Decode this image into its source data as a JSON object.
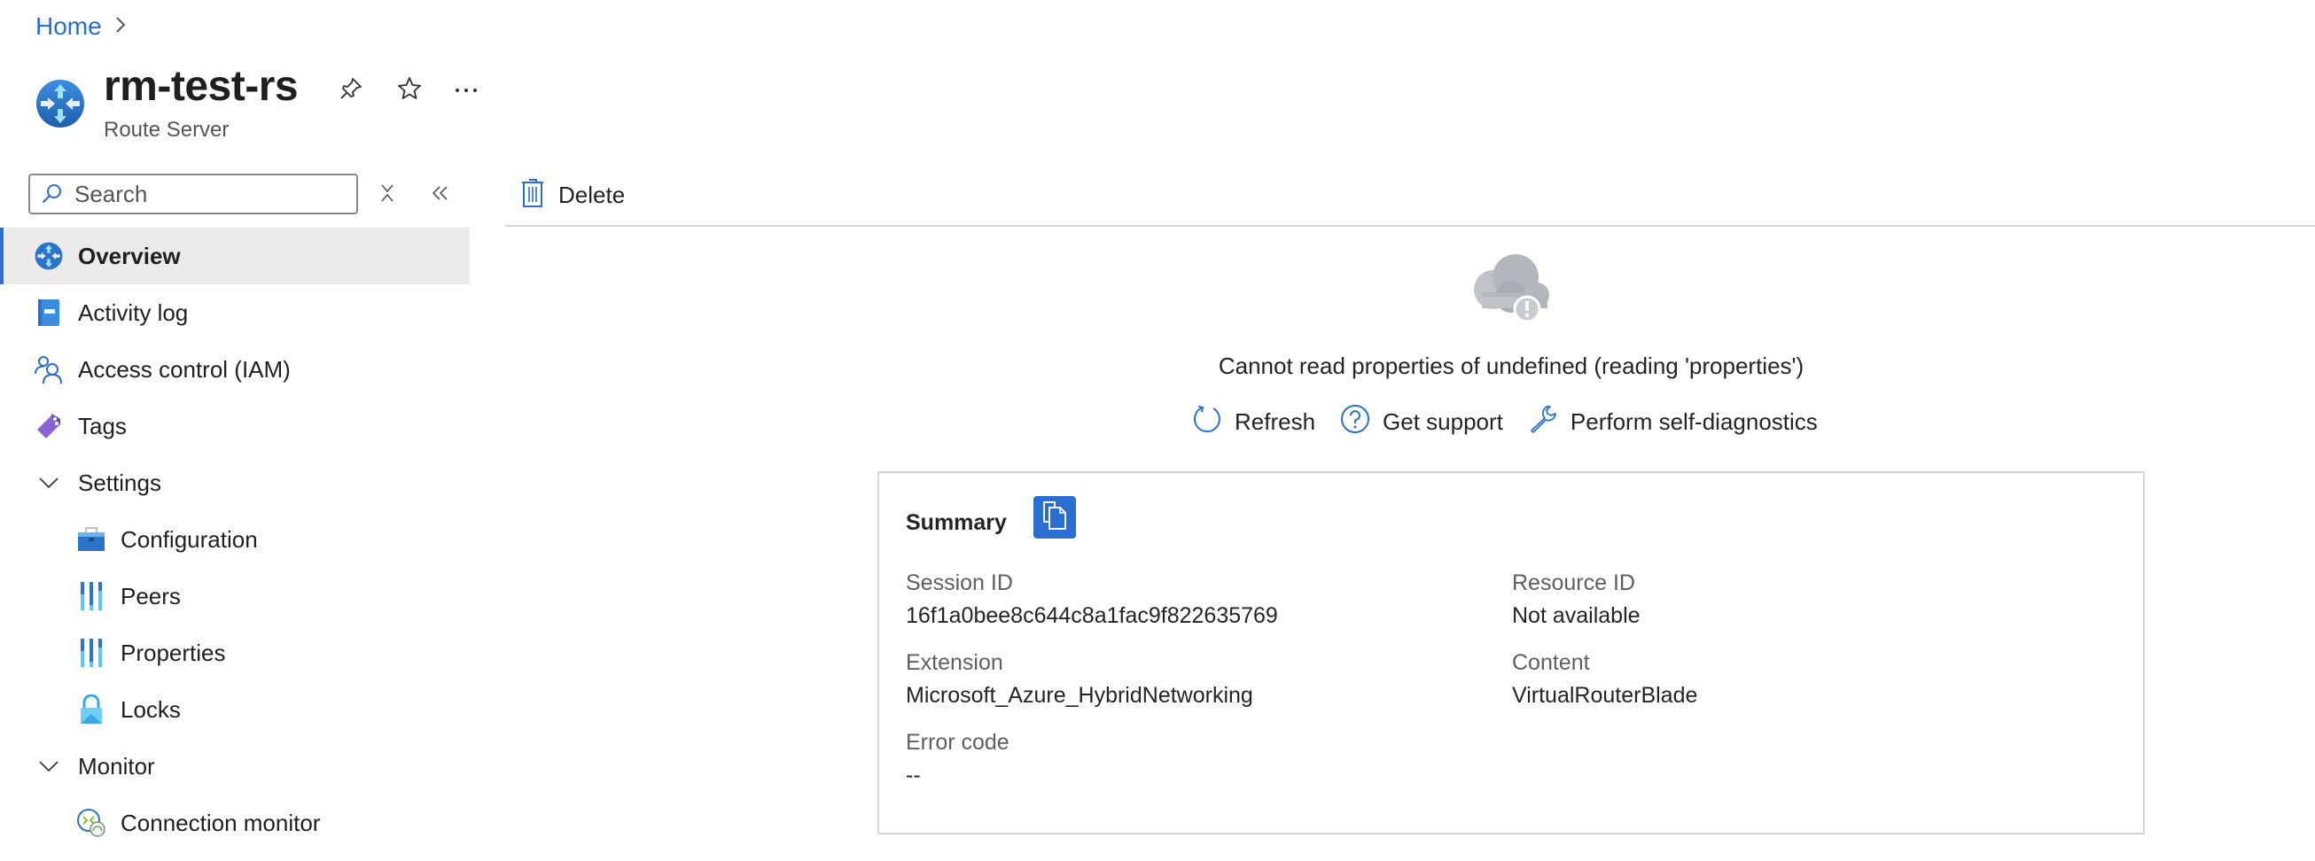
{
  "breadcrumb": {
    "home": "Home",
    "separator": "›"
  },
  "resource": {
    "title": "rm-test-rs",
    "type": "Route Server",
    "icon": "route-server-icon"
  },
  "header_actions": [
    {
      "name": "pin",
      "icon": "pin-icon"
    },
    {
      "name": "favorite",
      "icon": "star-icon"
    },
    {
      "name": "more",
      "icon": "ellipsis-icon",
      "label": "···"
    }
  ],
  "sidebar": {
    "search_placeholder": "Search",
    "search_value": "",
    "items": [
      {
        "label": "Overview",
        "icon": "route-server-icon",
        "level": 0,
        "active": true
      },
      {
        "label": "Activity log",
        "icon": "activity-log-icon",
        "level": 0
      },
      {
        "label": "Access control (IAM)",
        "icon": "iam-icon",
        "level": 0
      },
      {
        "label": "Tags",
        "icon": "tag-icon",
        "level": 0
      },
      {
        "label": "Settings",
        "icon": "chevron-down-icon",
        "level": 0,
        "group": true,
        "expanded": true
      },
      {
        "label": "Configuration",
        "icon": "toolbox-icon",
        "level": 1
      },
      {
        "label": "Peers",
        "icon": "properties-bars-icon",
        "level": 1
      },
      {
        "label": "Properties",
        "icon": "properties-bars-icon",
        "level": 1
      },
      {
        "label": "Locks",
        "icon": "lock-icon",
        "level": 1
      },
      {
        "label": "Monitor",
        "icon": "chevron-down-icon",
        "level": 0,
        "group": true,
        "expanded": true
      },
      {
        "label": "Connection monitor",
        "icon": "connection-monitor-icon",
        "level": 1
      }
    ]
  },
  "toolbar": {
    "delete_label": "Delete"
  },
  "error": {
    "message": "Cannot read properties of undefined (reading 'properties')",
    "actions": [
      {
        "label": "Refresh",
        "icon": "refresh-icon"
      },
      {
        "label": "Get support",
        "icon": "help-icon"
      },
      {
        "label": "Perform self-diagnostics",
        "icon": "wrench-icon"
      }
    ]
  },
  "summary": {
    "title": "Summary",
    "fields": {
      "session_id": {
        "label": "Session ID",
        "value": "16f1a0bee8c644c8a1fac9f822635769"
      },
      "resource_id": {
        "label": "Resource ID",
        "value": "Not available"
      },
      "extension": {
        "label": "Extension",
        "value": "Microsoft_Azure_HybridNetworking"
      },
      "content": {
        "label": "Content",
        "value": "VirtualRouterBlade"
      },
      "error_code": {
        "label": "Error code",
        "value": "--"
      }
    }
  },
  "colors": {
    "accent": "#2a6ed1",
    "active_bg": "#edebe9",
    "border": "#d6d6d6",
    "cloud": "#b3b6bb"
  }
}
